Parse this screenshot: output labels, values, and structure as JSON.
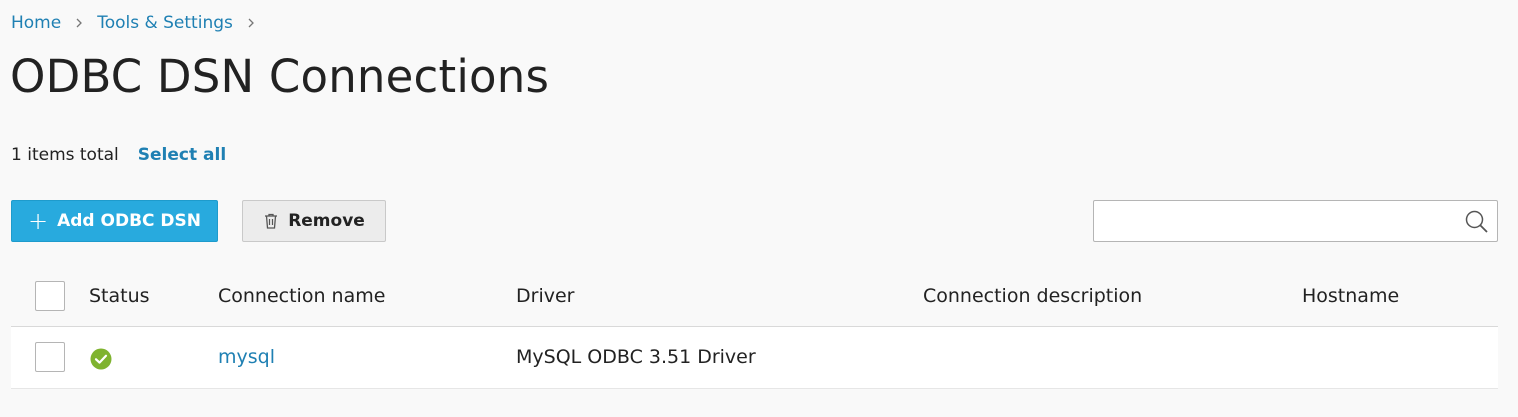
{
  "breadcrumb": {
    "items": [
      "Home",
      "Tools & Settings"
    ]
  },
  "page_title": "ODBC DSN Connections",
  "summary": {
    "items_total": "1 items total",
    "select_all": "Select all"
  },
  "toolbar": {
    "add_label": "Add ODBC DSN",
    "remove_label": "Remove"
  },
  "search": {
    "value": "",
    "placeholder": ""
  },
  "table": {
    "columns": [
      "Status",
      "Connection name",
      "Driver",
      "Connection description",
      "Hostname"
    ],
    "rows": [
      {
        "status": "ok",
        "connection_name": "mysql",
        "driver": "MySQL ODBC 3.51 Driver",
        "description": "",
        "hostname": ""
      }
    ]
  },
  "colors": {
    "link": "#1f80b3",
    "primary_button": "#28aade",
    "status_ok": "#7fb32f"
  },
  "icons": {
    "breadcrumb_separator": "chevron-right-icon",
    "add": "plus-icon",
    "remove": "trash-icon",
    "search": "search-icon",
    "status": "check-circle-icon"
  }
}
